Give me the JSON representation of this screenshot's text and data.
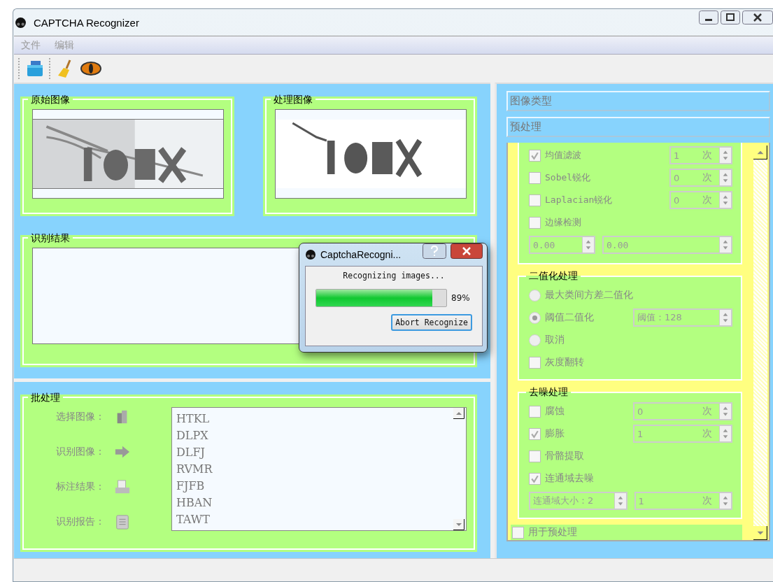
{
  "window": {
    "title": "CAPTCHA Recognizer"
  },
  "menu": [
    {
      "label": "文件"
    },
    {
      "label": "编辑"
    }
  ],
  "original_image": {
    "title": "原始图像"
  },
  "processed_image": {
    "title": "处理图像"
  },
  "result": {
    "title": "识别结果"
  },
  "batch": {
    "title": "批处理",
    "actions": [
      {
        "label": "选择图像：",
        "kind": "book"
      },
      {
        "label": "识别图像：",
        "kind": "arrow"
      },
      {
        "label": "标注结果：",
        "kind": "tray"
      },
      {
        "label": "识别报告：",
        "kind": "clipboard"
      }
    ],
    "results": [
      "HTKL",
      "DLPX",
      "DLFJ",
      "RVMR",
      "FJFB",
      "HBAN",
      "TAWT"
    ]
  },
  "side": {
    "headers": [
      {
        "label": "图像类型"
      },
      {
        "label": "预处理"
      }
    ],
    "preprocess": [
      {
        "kind": "check",
        "label": "均值滤波",
        "checked": true,
        "spin": {
          "value": "1",
          "unit": "次"
        }
      },
      {
        "kind": "check",
        "label": "Sobel锐化",
        "checked": false,
        "spin": {
          "value": "0",
          "unit": "次"
        }
      },
      {
        "kind": "check",
        "label": "Laplacian锐化",
        "checked": false,
        "spin": {
          "value": "0",
          "unit": "次"
        }
      },
      {
        "kind": "check",
        "label": "边缘检测",
        "checked": false
      },
      {
        "kind": "spins",
        "spins": [
          {
            "value": "0.00"
          },
          {
            "value": "0.00"
          }
        ]
      }
    ],
    "binarize": {
      "title": "二值化处理",
      "rows": [
        {
          "kind": "radio",
          "label": "最大类间方差二值化",
          "selected": false
        },
        {
          "kind": "radio",
          "label": "阈值二值化",
          "selected": true,
          "spin": {
            "value": "阈值：128"
          }
        },
        {
          "kind": "radio",
          "label": "取消",
          "selected": false
        },
        {
          "kind": "check",
          "label": "灰度翻转",
          "checked": false
        }
      ]
    },
    "denoise": {
      "title": "去噪处理",
      "rows": [
        {
          "kind": "check",
          "label": "腐蚀",
          "checked": false,
          "spin": {
            "value": "0",
            "unit": "次"
          }
        },
        {
          "kind": "check",
          "label": "膨胀",
          "checked": true,
          "spin": {
            "value": "1",
            "unit": "次"
          }
        },
        {
          "kind": "check",
          "label": "骨骼提取",
          "checked": false
        },
        {
          "kind": "check",
          "label": "连通域去噪",
          "checked": true
        },
        {
          "kind": "spins",
          "spins": [
            {
              "value": "连通域大小：2"
            },
            {
              "value": "1",
              "unit": "次"
            }
          ]
        }
      ]
    },
    "use_for_preprocess": {
      "label": "用于预处理",
      "checked": false
    }
  },
  "dialog": {
    "title": "CaptchaRecogni...",
    "message": "Recognizing images...",
    "progress": {
      "level": 0.89,
      "reading": "89%"
    },
    "button": "Abort Recognize"
  }
}
